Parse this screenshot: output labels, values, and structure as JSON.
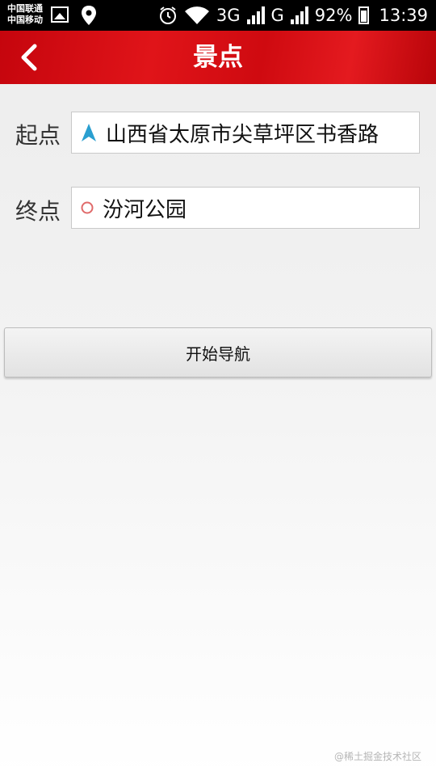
{
  "status_bar": {
    "carrier_1": "中国联通",
    "carrier_2": "中国移动",
    "network_1": "3G",
    "network_2": "G",
    "battery": "92%",
    "time": "13:39"
  },
  "header": {
    "title": "景点"
  },
  "route": {
    "start_label": "起点",
    "start_value": "山西省太原市尖草坪区书香路",
    "end_label": "终点",
    "end_value": "汾河公园"
  },
  "actions": {
    "start_navigation": "开始导航"
  },
  "watermark": "@稀土掘金技术社区",
  "colors": {
    "header_red": "#d50f14",
    "start_icon": "#2a9fd0",
    "end_icon": "#e06a6a"
  }
}
